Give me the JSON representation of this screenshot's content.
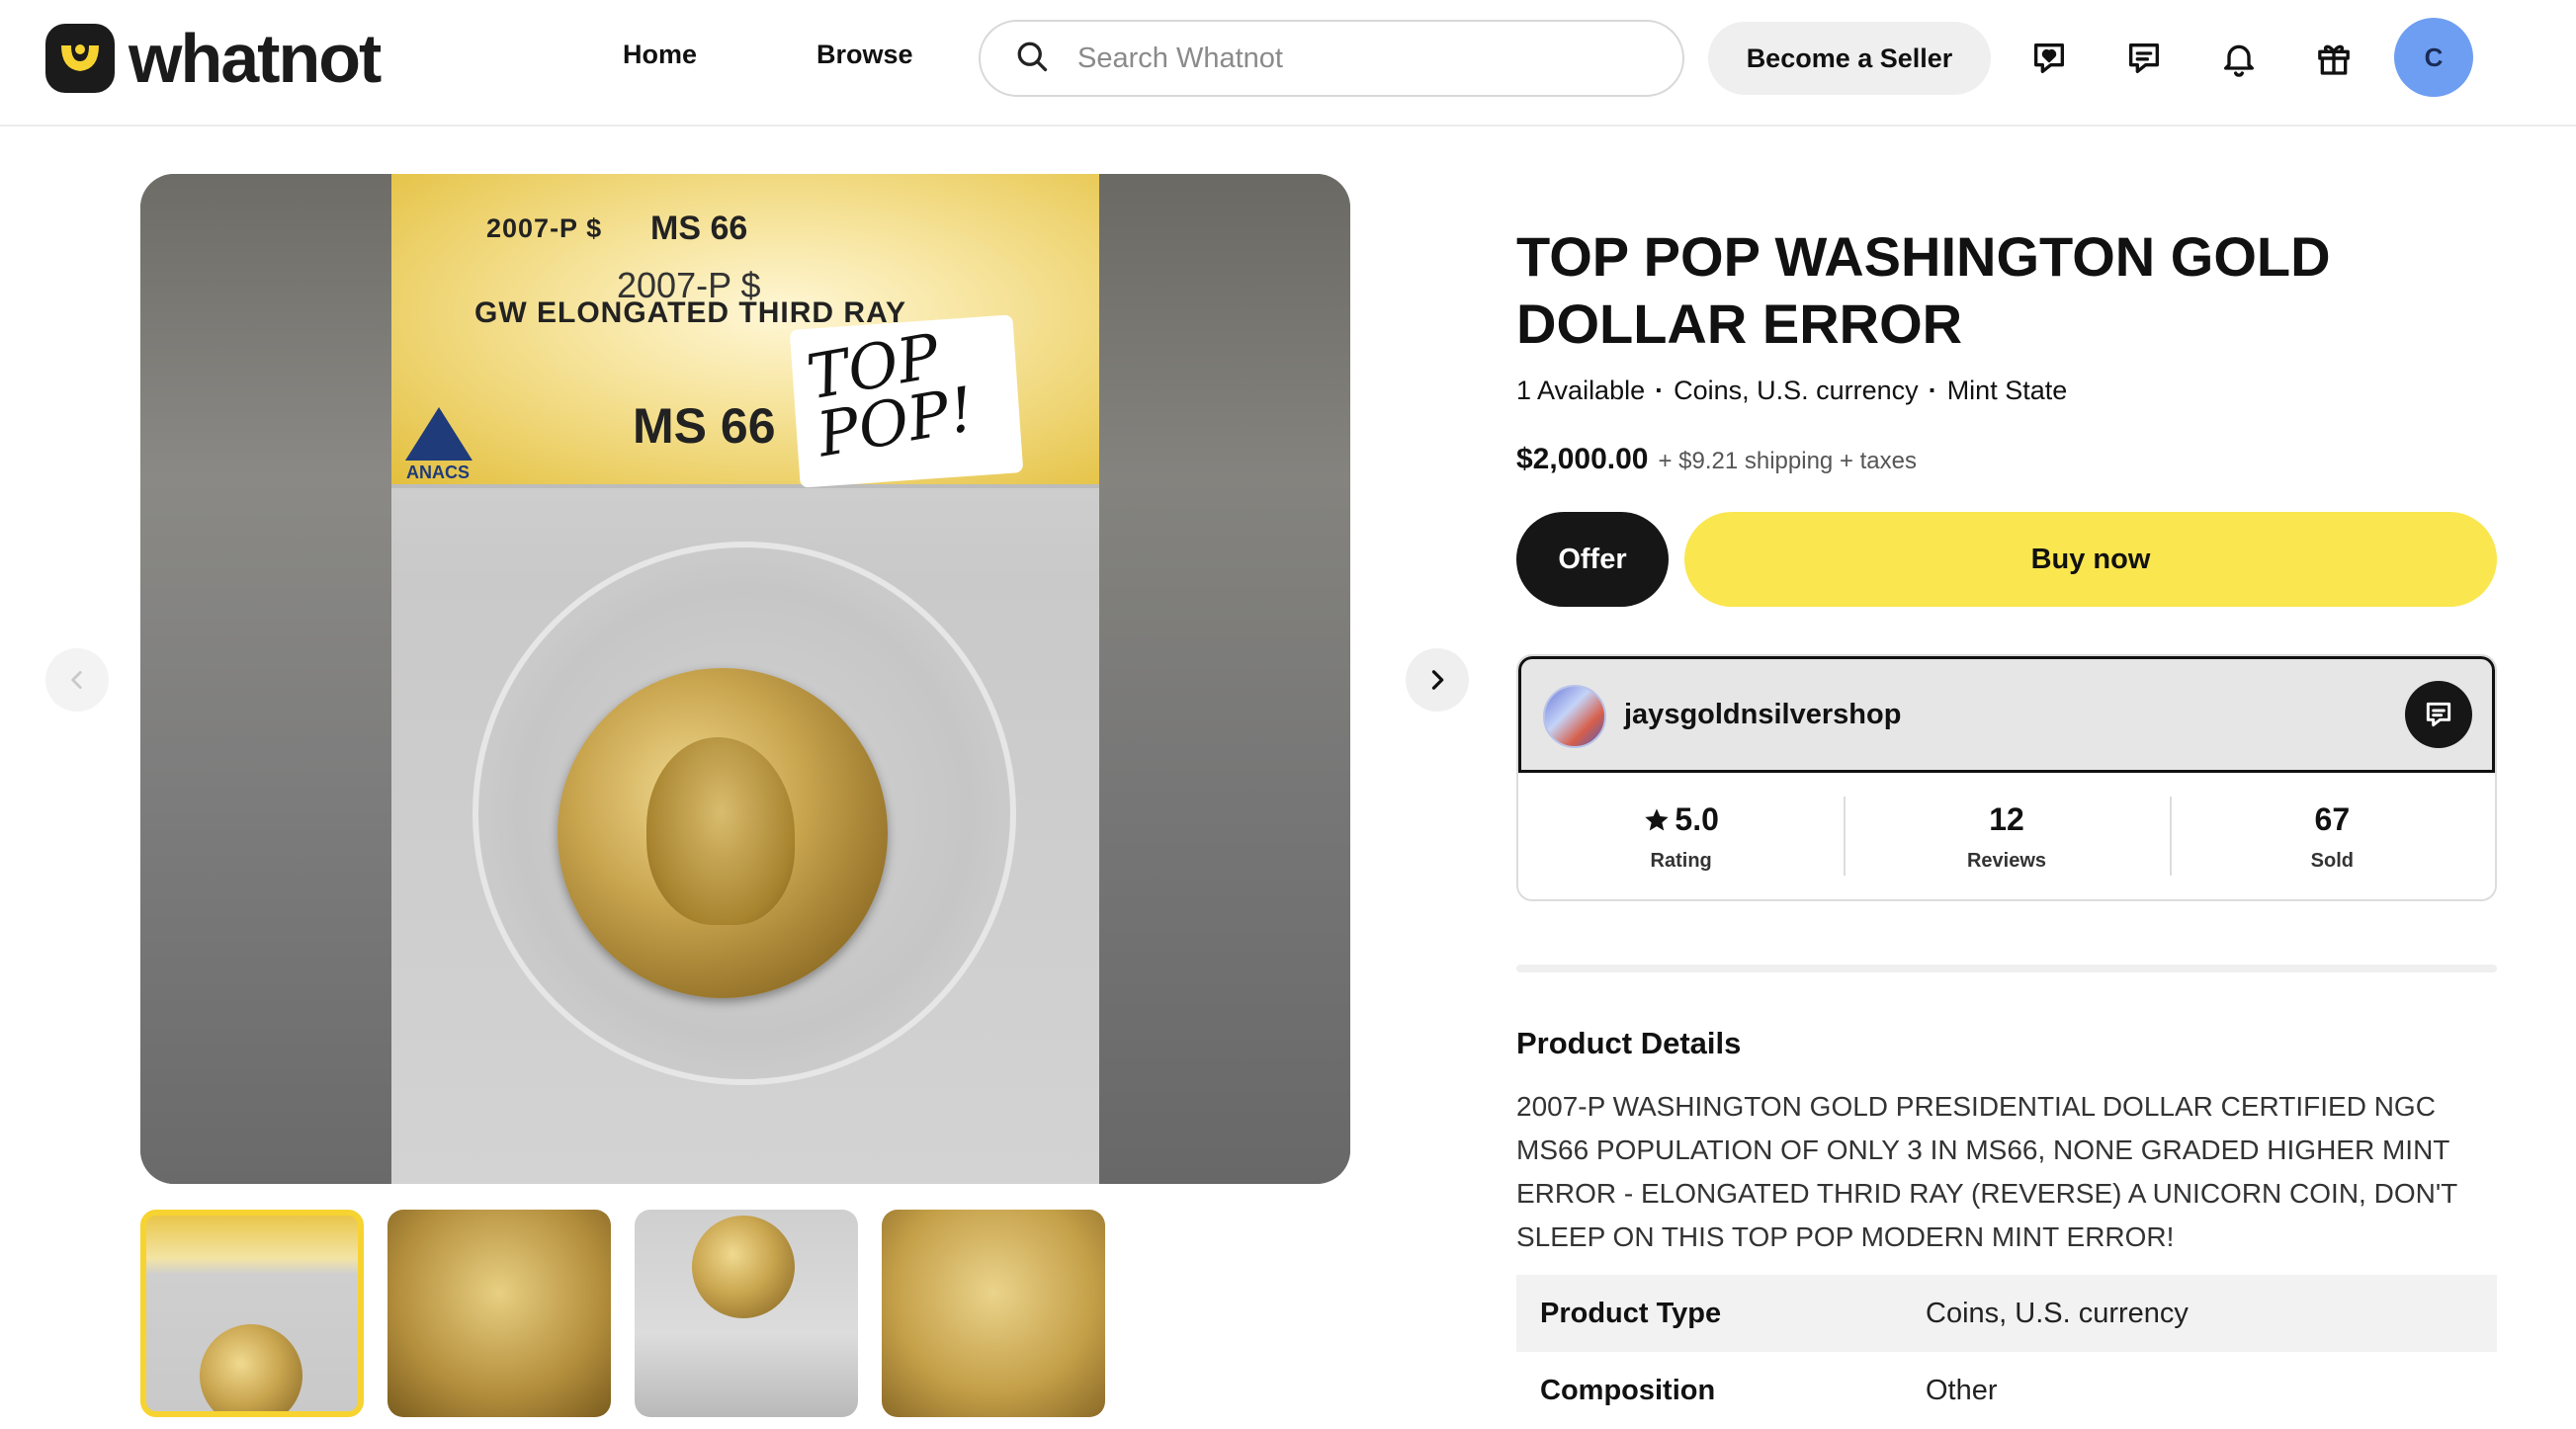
{
  "header": {
    "brand": "whatnot",
    "nav": {
      "home": "Home",
      "browse": "Browse"
    },
    "search": {
      "placeholder": "Search Whatnot",
      "value": ""
    },
    "become_seller": "Become a Seller",
    "icons": [
      "heart-chat-icon",
      "messages-icon",
      "bell-icon",
      "gift-icon"
    ],
    "avatar_initial": "C",
    "avatar_color": "#6d9ef2"
  },
  "gallery": {
    "main_image": {
      "label_top": "2007-P $",
      "label_grade_top": "MS 66",
      "label_line2": "2007-P $",
      "label_line3": "GW ELONGATED THIRD RAY",
      "label_grade": "MS 66",
      "label_brand": "ANACS",
      "sticker_text": "TOP POP!"
    },
    "thumbnails": [
      {
        "name": "thumb-slab",
        "selected": true
      },
      {
        "name": "thumb-obverse",
        "selected": false
      },
      {
        "name": "thumb-slab-angle",
        "selected": false
      },
      {
        "name": "thumb-reverse",
        "selected": false
      }
    ],
    "selected_color": "#f7d331"
  },
  "product": {
    "title": "TOP POP WASHINGTON GOLD DOLLAR ERROR",
    "availability": "1 Available",
    "category": "Coins, U.S. currency",
    "condition": "Mint State",
    "price": "$2,000.00",
    "shipping": "+ $9.21 shipping + taxes",
    "offer_label": "Offer",
    "buy_label": "Buy now",
    "buy_color": "#fae64f"
  },
  "seller": {
    "name": "jaysgoldnsilvershop",
    "stats": [
      {
        "value": "5.0",
        "label": "Rating",
        "star": true
      },
      {
        "value": "12",
        "label": "Reviews",
        "star": false
      },
      {
        "value": "67",
        "label": "Sold",
        "star": false
      }
    ]
  },
  "details": {
    "heading": "Product Details",
    "description": "2007-P WASHINGTON GOLD PRESIDENTIAL DOLLAR CERTIFIED NGC MS66 POPULATION OF ONLY 3 IN MS66, NONE GRADED HIGHER MINT ERROR - ELONGATED THRID RAY (REVERSE) A UNICORN COIN, DON'T SLEEP ON THIS TOP POP MODERN MINT ERROR!",
    "rows": [
      {
        "key": "Product Type",
        "value": "Coins, U.S. currency"
      },
      {
        "key": "Composition",
        "value": "Other"
      }
    ]
  }
}
